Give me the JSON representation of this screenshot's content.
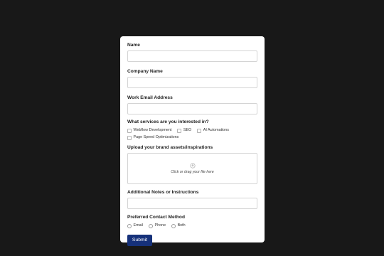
{
  "form": {
    "name_label": "Name",
    "company_label": "Company Name",
    "email_label": "Work Email Address",
    "services_label": "What services are you interested in?",
    "services": [
      "Webflow Development",
      "SEO",
      "AI Automations",
      "Page Speed Optimizations"
    ],
    "upload_label": "Upload your brand assets/inspirations",
    "upload_hint": "Click or drag your file here",
    "upload_icon": "upload-icon",
    "notes_label": "Additional Notes or Instructions",
    "contact_label": "Preferred Contact Method",
    "contact_options": [
      "Email",
      "Phone",
      "Both"
    ],
    "submit_label": "Submit"
  },
  "colors": {
    "background": "#181818",
    "card": "#ffffff",
    "accent": "#16317a"
  }
}
